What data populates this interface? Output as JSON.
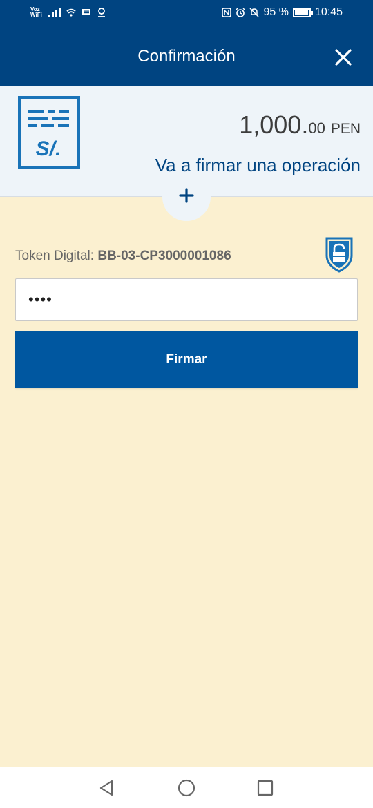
{
  "status_bar": {
    "carrier_label_top": "Voz",
    "carrier_label_bottom": "WiFi",
    "battery_percent": "95 %",
    "time": "10:45",
    "icons": [
      "signal-icon",
      "wifi-icon",
      "message-icon",
      "location-icon",
      "nfc-icon",
      "alarm-icon",
      "mute-icon",
      "battery-icon"
    ]
  },
  "header": {
    "title": "Confirmación",
    "close_icon": "close-icon"
  },
  "summary": {
    "currency_icon_text": "S/.",
    "amount_integer": "1,000.",
    "amount_decimals": "00",
    "currency": "PEN",
    "operation_text": "Va a firmar una operación",
    "expand_icon": "plus-icon"
  },
  "token": {
    "label": "Token Digital: ",
    "code": "BB-03-CP3000001086",
    "icon": "shield-lock-icon",
    "input_value": "••••"
  },
  "sign_button": {
    "label": "Firmar"
  },
  "navbar": {
    "icons": [
      "back-icon",
      "home-icon",
      "recents-icon"
    ]
  },
  "colors": {
    "brand": "#004481",
    "button": "#0057a0",
    "background": "#fbf0d0",
    "summary_bg": "#eef4f9",
    "icon_blue": "#1973b8"
  }
}
